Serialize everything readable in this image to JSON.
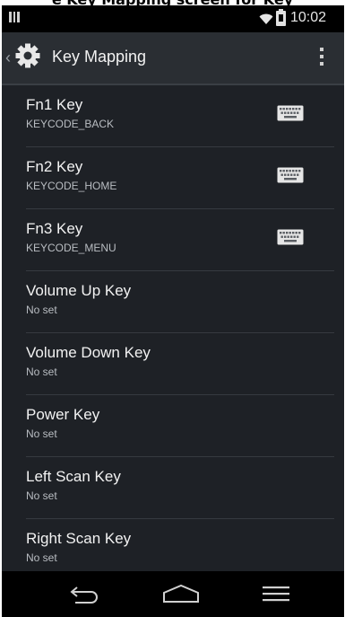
{
  "header_caption": "e Key Mapping screen for Key",
  "status_bar": {
    "time": "10:02"
  },
  "action_bar": {
    "title": "Key Mapping",
    "icons": {
      "app": "gear-icon",
      "menu": "overflow-menu-icon"
    }
  },
  "keys": [
    {
      "name": "Fn1 Key",
      "value": "KEYCODE_BACK",
      "icon": "keyboard-icon"
    },
    {
      "name": "Fn2 Key",
      "value": "KEYCODE_HOME",
      "icon": "keyboard-icon"
    },
    {
      "name": "Fn3 Key",
      "value": "KEYCODE_MENU",
      "icon": "keyboard-icon"
    },
    {
      "name": "Volume Up Key",
      "value": "No set"
    },
    {
      "name": "Volume Down Key",
      "value": "No set"
    },
    {
      "name": "Power Key",
      "value": "No set"
    },
    {
      "name": "Left Scan Key",
      "value": "No set"
    },
    {
      "name": "Right Scan Key",
      "value": "No set"
    }
  ],
  "nav_bar": {
    "icons": [
      "back-icon",
      "home-icon",
      "recents-icon"
    ]
  },
  "colors": {
    "background": "#1e2126",
    "action_bar": "#2a2e33",
    "status_bar": "#000000",
    "primary_text": "#f2f2f2",
    "secondary_text": "#b9bdc2"
  }
}
